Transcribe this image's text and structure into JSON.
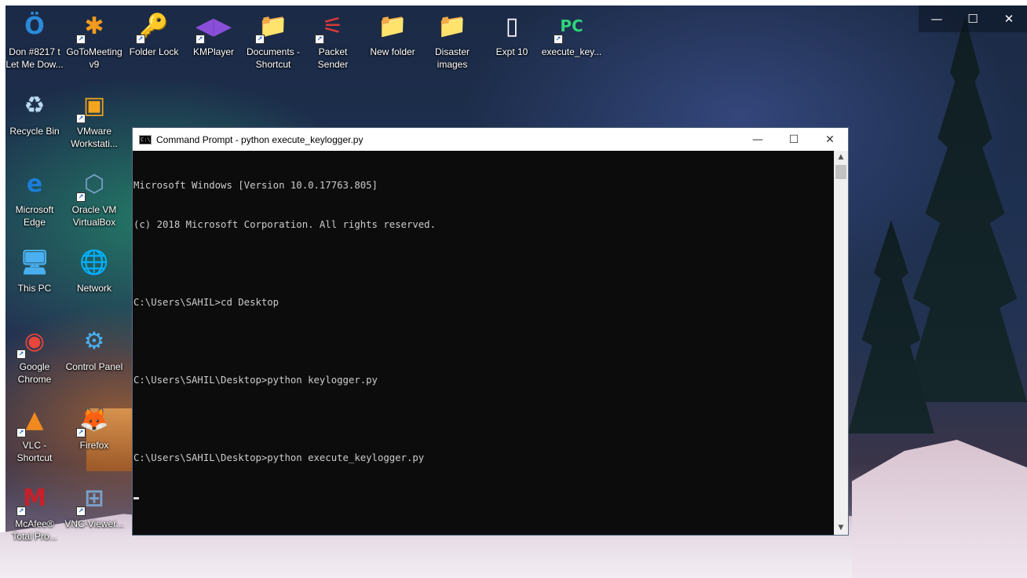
{
  "desktop": {
    "icons": [
      {
        "label": "Don #8217 t\nLet Me Dow...",
        "glyph": "Ö",
        "color": "#2a8ad8"
      },
      {
        "label": "GoToMeeting\nv9",
        "glyph": "✱",
        "color": "#f39a1e"
      },
      {
        "label": "Folder Lock",
        "glyph": "🔑",
        "color": "#1a6ec4"
      },
      {
        "label": "KMPlayer",
        "glyph": "◀▶",
        "color": "#8a4fd8"
      },
      {
        "label": "Documents -\nShortcut",
        "glyph": "📁",
        "color": "#e8c15a"
      },
      {
        "label": "Packet\nSender",
        "glyph": "⚟",
        "color": "#d83a3a"
      },
      {
        "label": "New folder",
        "glyph": "📁",
        "color": "#e8c15a"
      },
      {
        "label": "Disaster\nimages",
        "glyph": "📁",
        "color": "#e8c15a"
      },
      {
        "label": "Expt 10",
        "glyph": "▯",
        "color": "#ffffff"
      },
      {
        "label": "execute_key...",
        "glyph": "PC",
        "color": "#2ed37a"
      },
      {
        "label": "Recycle Bin",
        "glyph": "♻",
        "color": "#b8d8f0"
      },
      {
        "label": "VMware\nWorkstati...",
        "glyph": "▣",
        "color": "#f3a51e"
      },
      {
        "label": "Microsoft\nEdge",
        "glyph": "e",
        "color": "#1a7ed8"
      },
      {
        "label": "Oracle VM\nVirtualBox",
        "glyph": "⬡",
        "color": "#7aa0c8"
      },
      {
        "label": "This PC",
        "glyph": "🖥",
        "color": "#4ab0f0"
      },
      {
        "label": "Network",
        "glyph": "🌐",
        "color": "#4ab0f0"
      },
      {
        "label": "Google\nChrome",
        "glyph": "◉",
        "color": "#e8453c"
      },
      {
        "label": "Control Panel",
        "glyph": "⚙",
        "color": "#4ab0f0"
      },
      {
        "label": "VLC -\nShortcut",
        "glyph": "▲",
        "color": "#f08a1e"
      },
      {
        "label": "Firefox",
        "glyph": "🦊",
        "color": "#f07a1e"
      },
      {
        "label": "McAfee®\nTotal Pro...",
        "glyph": "M",
        "color": "#c8202a"
      },
      {
        "label": "VNC-Viewer...",
        "glyph": "⊞",
        "color": "#7aa0c8"
      }
    ]
  },
  "outer_controls": {
    "minimize": "—",
    "maximize": "☐",
    "close": "✕"
  },
  "cmd": {
    "title": "Command Prompt - python  execute_keylogger.py",
    "icon_text": "C:\\",
    "minimize": "—",
    "maximize": "☐",
    "close": "✕",
    "lines": [
      "Microsoft Windows [Version 10.0.17763.805]",
      "(c) 2018 Microsoft Corporation. All rights reserved.",
      "",
      "C:\\Users\\SAHIL>cd Desktop",
      "",
      "C:\\Users\\SAHIL\\Desktop>python keylogger.py",
      "",
      "C:\\Users\\SAHIL\\Desktop>python execute_keylogger.py",
      ""
    ],
    "scroll_up": "▲",
    "scroll_down": "▼"
  }
}
